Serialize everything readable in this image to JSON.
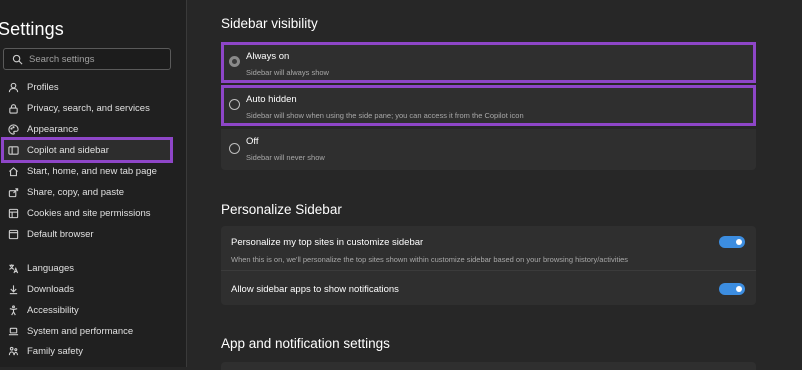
{
  "sidebar": {
    "title": "Settings",
    "search_placeholder": "Search settings",
    "items": [
      {
        "label": "Profiles",
        "icon": "profile-icon"
      },
      {
        "label": "Privacy, search, and services",
        "icon": "lock-icon"
      },
      {
        "label": "Appearance",
        "icon": "palette-icon"
      },
      {
        "label": "Copilot and sidebar",
        "icon": "sidebar-icon",
        "active": true
      },
      {
        "label": "Start, home, and new tab page",
        "icon": "home-icon"
      },
      {
        "label": "Share, copy, and paste",
        "icon": "share-icon"
      },
      {
        "label": "Cookies and site permissions",
        "icon": "cookie-icon"
      },
      {
        "label": "Default browser",
        "icon": "browser-icon"
      },
      {
        "label": "Languages",
        "icon": "languages-icon"
      },
      {
        "label": "Downloads",
        "icon": "download-icon"
      },
      {
        "label": "Accessibility",
        "icon": "accessibility-icon"
      },
      {
        "label": "System and performance",
        "icon": "laptop-icon"
      },
      {
        "label": "Family safety",
        "icon": "family-icon"
      }
    ]
  },
  "visibility": {
    "title": "Sidebar visibility",
    "options": [
      {
        "title": "Always on",
        "subtitle": "Sidebar will always show",
        "selected": true,
        "highlighted": true
      },
      {
        "title": "Auto hidden",
        "subtitle": "Sidebar will show when using the side pane; you can access it from the Copilot icon",
        "selected": false,
        "highlighted": true
      },
      {
        "title": "Off",
        "subtitle": "Sidebar will never show",
        "selected": false,
        "highlighted": false
      }
    ]
  },
  "personalize": {
    "title": "Personalize Sidebar",
    "top_sites": {
      "title": "Personalize my top sites in customize sidebar",
      "subtitle": "When this is on, we'll personalize the top sites shown within customize sidebar based on your browsing history/activities",
      "enabled": true
    },
    "notifications": {
      "title": "Allow sidebar apps to show notifications",
      "enabled": true
    }
  },
  "app_settings": {
    "title": "App and notification settings"
  },
  "colors": {
    "highlight": "#8e46c8",
    "toggle_on": "#3c8de0",
    "background": "#272727",
    "sidebar_bg": "#202020",
    "card_bg": "#2f2f2f"
  }
}
